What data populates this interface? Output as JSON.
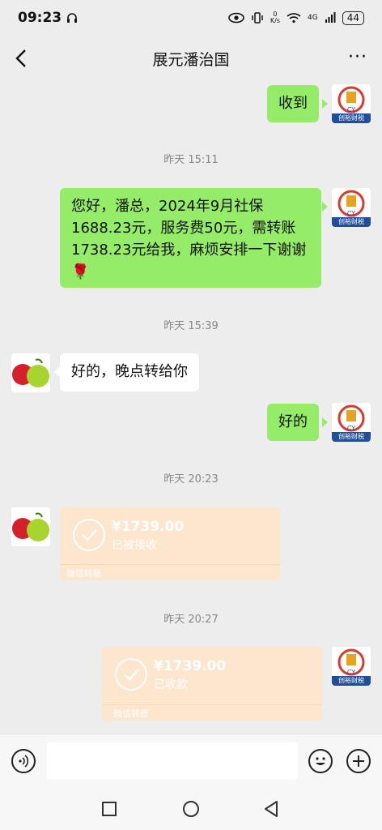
{
  "status_bar": {
    "time": "09:23",
    "net_speed": "0\nK/s",
    "signal_label": "4G",
    "battery": "44"
  },
  "header": {
    "title": "展元潘治国",
    "more_label": "···"
  },
  "contact_logo_caption": "创裕财税",
  "messages": {
    "m1": "收到",
    "t1": "昨天 15:11",
    "m2": "您好，潘总，2024年9月社保1688.23元，服务费50元，需转账1738.23元给我，麻烦安排一下谢谢🌹",
    "t2": "昨天 15:39",
    "m3": "好的，晚点转给你",
    "m4": "好的",
    "t3": "昨天 20:23",
    "tr1": {
      "amount": "¥1739.00",
      "status": "已被接收",
      "foot": "微信转账"
    },
    "t4": "昨天 20:27",
    "tr2": {
      "amount": "¥1739.00",
      "status": "已收款",
      "foot": "微信转账"
    }
  },
  "colors": {
    "bubble_green": "#95ec69",
    "transfer_bg": "#fce6ce",
    "chat_bg": "#ededed"
  }
}
